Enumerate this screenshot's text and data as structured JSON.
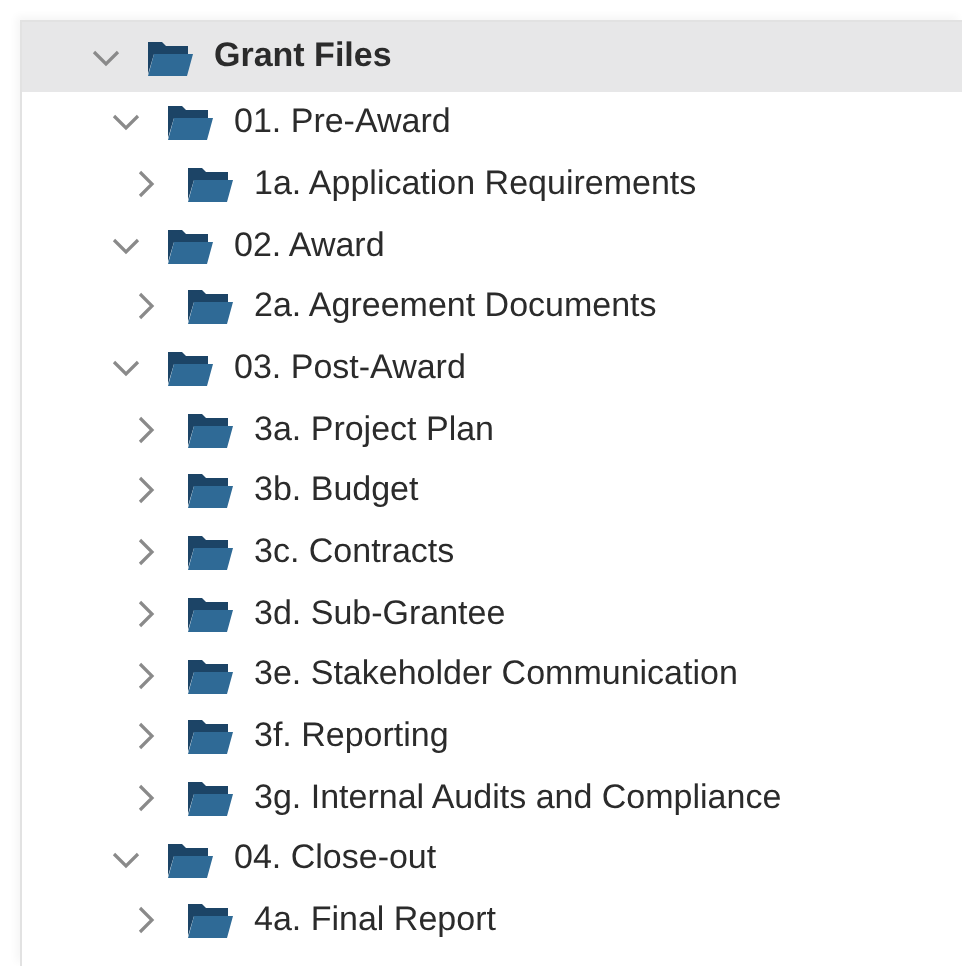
{
  "tree": [
    {
      "label": "Grant Files",
      "selected": true,
      "expanded": true,
      "children": [
        {
          "label": "01. Pre-Award",
          "selected": false,
          "expanded": true,
          "children": [
            {
              "label": "1a. Application Requirements",
              "selected": false,
              "expanded": false
            }
          ]
        },
        {
          "label": "02. Award",
          "selected": false,
          "expanded": true,
          "children": [
            {
              "label": "2a. Agreement Documents",
              "selected": false,
              "expanded": false
            }
          ]
        },
        {
          "label": "03. Post-Award",
          "selected": false,
          "expanded": true,
          "children": [
            {
              "label": "3a. Project Plan",
              "selected": false,
              "expanded": false
            },
            {
              "label": "3b. Budget",
              "selected": false,
              "expanded": false
            },
            {
              "label": "3c. Contracts",
              "selected": false,
              "expanded": false
            },
            {
              "label": "3d. Sub-Grantee",
              "selected": false,
              "expanded": false
            },
            {
              "label": "3e. Stakeholder Communication",
              "selected": false,
              "expanded": false
            },
            {
              "label": "3f. Reporting",
              "selected": false,
              "expanded": false
            },
            {
              "label": "3g. Internal Audits and Compliance",
              "selected": false,
              "expanded": false
            }
          ]
        },
        {
          "label": "04. Close-out",
          "selected": false,
          "expanded": true,
          "children": [
            {
              "label": "4a. Final Report",
              "selected": false,
              "expanded": false
            }
          ]
        }
      ]
    }
  ]
}
